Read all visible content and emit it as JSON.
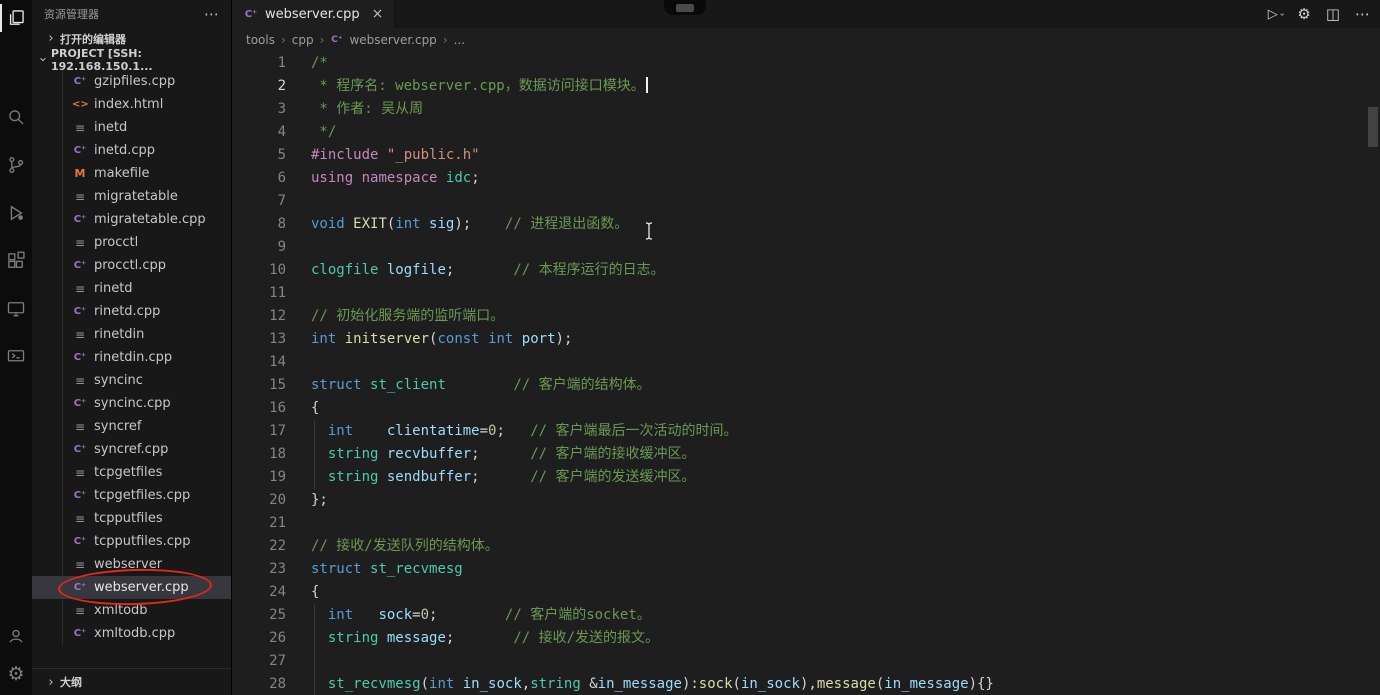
{
  "icons": {
    "more": "⋯",
    "chevron": "›",
    "close": "×",
    "gear": "⚙",
    "split": "◫",
    "play": "▷",
    "cpp": "C⁺",
    "html": "<>",
    "makefile": "M",
    "file": "≡"
  },
  "colors": {
    "comment": "#6A9955",
    "keyword": "#569CD6",
    "preprocessor": "#C586C0",
    "string": "#CE9178",
    "type": "#4EC9B0",
    "function": "#DCDCAA",
    "variable": "#9CDCFE",
    "number": "#B5CEA8",
    "annotation_red": "#e0281e",
    "cpp_icon": "#a074c4",
    "html_icon": "#e37933",
    "selected_row_bg": "#37373d"
  },
  "activity_bar": {
    "items": [
      "explorer",
      "search",
      "source-control",
      "run-and-debug",
      "extensions",
      "remote-explorer",
      "remote-targets"
    ],
    "bottom_items": [
      "accounts",
      "settings"
    ]
  },
  "sidebar": {
    "title": "资源管理器",
    "sections": {
      "open_editors": "打开的编辑器",
      "project": "PROJECT [SSH: 192.168.150.1...",
      "outline": "大纲"
    },
    "files": [
      {
        "name": "gzipfiles.cpp",
        "icon": "cpp"
      },
      {
        "name": "index.html",
        "icon": "html"
      },
      {
        "name": "inetd",
        "icon": "file"
      },
      {
        "name": "inetd.cpp",
        "icon": "cpp"
      },
      {
        "name": "makefile",
        "icon": "makefile"
      },
      {
        "name": "migratetable",
        "icon": "file"
      },
      {
        "name": "migratetable.cpp",
        "icon": "cpp"
      },
      {
        "name": "procctl",
        "icon": "file"
      },
      {
        "name": "procctl.cpp",
        "icon": "cpp"
      },
      {
        "name": "rinetd",
        "icon": "file"
      },
      {
        "name": "rinetd.cpp",
        "icon": "cpp"
      },
      {
        "name": "rinetdin",
        "icon": "file"
      },
      {
        "name": "rinetdin.cpp",
        "icon": "cpp"
      },
      {
        "name": "syncinc",
        "icon": "file"
      },
      {
        "name": "syncinc.cpp",
        "icon": "cpp"
      },
      {
        "name": "syncref",
        "icon": "file"
      },
      {
        "name": "syncref.cpp",
        "icon": "cpp"
      },
      {
        "name": "tcpgetfiles",
        "icon": "file"
      },
      {
        "name": "tcpgetfiles.cpp",
        "icon": "cpp"
      },
      {
        "name": "tcpputfiles",
        "icon": "file"
      },
      {
        "name": "tcpputfiles.cpp",
        "icon": "cpp"
      },
      {
        "name": "webserver",
        "icon": "file"
      },
      {
        "name": "webserver.cpp",
        "icon": "cpp",
        "selected": true,
        "annotated": true
      },
      {
        "name": "xmltodb",
        "icon": "file"
      },
      {
        "name": "xmltodb.cpp",
        "icon": "cpp"
      }
    ]
  },
  "editor": {
    "tab": "webserver.cpp",
    "breadcrumbs": [
      "tools",
      "cpp",
      "webserver.cpp",
      "..."
    ],
    "lines": [
      {
        "n": 1,
        "tokens": [
          {
            "s": "comment",
            "t": "/*"
          }
        ]
      },
      {
        "n": 2,
        "active": true,
        "tokens": [
          {
            "s": "comment",
            "t": " * 程序名: webserver.cpp，数据访问接口模块。"
          },
          {
            "s": "caret",
            "t": ""
          }
        ]
      },
      {
        "n": 3,
        "tokens": [
          {
            "s": "comment",
            "t": " * 作者: 吴从周"
          }
        ]
      },
      {
        "n": 4,
        "tokens": [
          {
            "s": "comment",
            "t": " */"
          }
        ]
      },
      {
        "n": 5,
        "tokens": [
          {
            "s": "kw2",
            "t": "#include"
          },
          {
            "s": "plain",
            "t": " "
          },
          {
            "s": "str",
            "t": "\"_public.h\""
          }
        ]
      },
      {
        "n": 6,
        "tokens": [
          {
            "s": "kw2",
            "t": "using"
          },
          {
            "s": "plain",
            "t": " "
          },
          {
            "s": "kw2",
            "t": "namespace"
          },
          {
            "s": "plain",
            "t": " "
          },
          {
            "s": "type",
            "t": "idc"
          },
          {
            "s": "plain",
            "t": ";"
          }
        ]
      },
      {
        "n": 7,
        "tokens": []
      },
      {
        "n": 8,
        "tokens": [
          {
            "s": "kw",
            "t": "void"
          },
          {
            "s": "plain",
            "t": " "
          },
          {
            "s": "fn",
            "t": "EXIT"
          },
          {
            "s": "plain",
            "t": "("
          },
          {
            "s": "kw",
            "t": "int"
          },
          {
            "s": "plain",
            "t": " "
          },
          {
            "s": "var",
            "t": "sig"
          },
          {
            "s": "plain",
            "t": ");    "
          },
          {
            "s": "comment",
            "t": "// 进程退出函数。"
          }
        ]
      },
      {
        "n": 9,
        "tokens": []
      },
      {
        "n": 10,
        "tokens": [
          {
            "s": "type",
            "t": "clogfile"
          },
          {
            "s": "plain",
            "t": " "
          },
          {
            "s": "var",
            "t": "logfile"
          },
          {
            "s": "plain",
            "t": ";       "
          },
          {
            "s": "comment",
            "t": "// 本程序运行的日志。"
          }
        ]
      },
      {
        "n": 11,
        "tokens": []
      },
      {
        "n": 12,
        "tokens": [
          {
            "s": "comment",
            "t": "// 初始化服务端的监听端口。"
          }
        ]
      },
      {
        "n": 13,
        "tokens": [
          {
            "s": "kw",
            "t": "int"
          },
          {
            "s": "plain",
            "t": " "
          },
          {
            "s": "fn",
            "t": "initserver"
          },
          {
            "s": "plain",
            "t": "("
          },
          {
            "s": "kw",
            "t": "const"
          },
          {
            "s": "plain",
            "t": " "
          },
          {
            "s": "kw",
            "t": "int"
          },
          {
            "s": "plain",
            "t": " "
          },
          {
            "s": "var",
            "t": "port"
          },
          {
            "s": "plain",
            "t": ");"
          }
        ]
      },
      {
        "n": 14,
        "tokens": []
      },
      {
        "n": 15,
        "tokens": [
          {
            "s": "kw",
            "t": "struct"
          },
          {
            "s": "plain",
            "t": " "
          },
          {
            "s": "type",
            "t": "st_client"
          },
          {
            "s": "plain",
            "t": "        "
          },
          {
            "s": "comment",
            "t": "// 客户端的结构体。"
          }
        ]
      },
      {
        "n": 16,
        "tokens": [
          {
            "s": "plain",
            "t": "{"
          }
        ]
      },
      {
        "n": 17,
        "tokens": [
          {
            "s": "plain",
            "t": "  "
          },
          {
            "s": "kw",
            "t": "int"
          },
          {
            "s": "plain",
            "t": "    "
          },
          {
            "s": "var",
            "t": "clientatime"
          },
          {
            "s": "plain",
            "t": "="
          },
          {
            "s": "num",
            "t": "0"
          },
          {
            "s": "plain",
            "t": ";   "
          },
          {
            "s": "comment",
            "t": "// 客户端最后一次活动的时间。"
          }
        ]
      },
      {
        "n": 18,
        "tokens": [
          {
            "s": "plain",
            "t": "  "
          },
          {
            "s": "type",
            "t": "string"
          },
          {
            "s": "plain",
            "t": " "
          },
          {
            "s": "var",
            "t": "recvbuffer"
          },
          {
            "s": "plain",
            "t": ";      "
          },
          {
            "s": "comment",
            "t": "// 客户端的接收缓冲区。"
          }
        ]
      },
      {
        "n": 19,
        "tokens": [
          {
            "s": "plain",
            "t": "  "
          },
          {
            "s": "type",
            "t": "string"
          },
          {
            "s": "plain",
            "t": " "
          },
          {
            "s": "var",
            "t": "sendbuffer"
          },
          {
            "s": "plain",
            "t": ";      "
          },
          {
            "s": "comment",
            "t": "// 客户端的发送缓冲区。"
          }
        ]
      },
      {
        "n": 20,
        "tokens": [
          {
            "s": "plain",
            "t": "};"
          }
        ]
      },
      {
        "n": 21,
        "tokens": []
      },
      {
        "n": 22,
        "tokens": [
          {
            "s": "comment",
            "t": "// 接收/发送队列的结构体。"
          }
        ]
      },
      {
        "n": 23,
        "tokens": [
          {
            "s": "kw",
            "t": "struct"
          },
          {
            "s": "plain",
            "t": " "
          },
          {
            "s": "type",
            "t": "st_recvmesg"
          }
        ]
      },
      {
        "n": 24,
        "tokens": [
          {
            "s": "plain",
            "t": "{"
          }
        ]
      },
      {
        "n": 25,
        "tokens": [
          {
            "s": "plain",
            "t": "  "
          },
          {
            "s": "kw",
            "t": "int"
          },
          {
            "s": "plain",
            "t": "   "
          },
          {
            "s": "var",
            "t": "sock"
          },
          {
            "s": "plain",
            "t": "="
          },
          {
            "s": "num",
            "t": "0"
          },
          {
            "s": "plain",
            "t": ";        "
          },
          {
            "s": "comment",
            "t": "// 客户端的socket。"
          }
        ]
      },
      {
        "n": 26,
        "tokens": [
          {
            "s": "plain",
            "t": "  "
          },
          {
            "s": "type",
            "t": "string"
          },
          {
            "s": "plain",
            "t": " "
          },
          {
            "s": "var",
            "t": "message"
          },
          {
            "s": "plain",
            "t": ";       "
          },
          {
            "s": "comment",
            "t": "// 接收/发送的报文。"
          }
        ]
      },
      {
        "n": 27,
        "tokens": []
      },
      {
        "n": 28,
        "tokens": [
          {
            "s": "plain",
            "t": "  "
          },
          {
            "s": "type",
            "t": "st_recvmesg"
          },
          {
            "s": "plain",
            "t": "("
          },
          {
            "s": "kw",
            "t": "int"
          },
          {
            "s": "plain",
            "t": " "
          },
          {
            "s": "var",
            "t": "in_sock"
          },
          {
            "s": "plain",
            "t": ","
          },
          {
            "s": "type",
            "t": "string"
          },
          {
            "s": "plain",
            "t": " &"
          },
          {
            "s": "var",
            "t": "in_message"
          },
          {
            "s": "plain",
            "t": "):"
          },
          {
            "s": "fn",
            "t": "sock"
          },
          {
            "s": "plain",
            "t": "("
          },
          {
            "s": "var",
            "t": "in_sock"
          },
          {
            "s": "plain",
            "t": "),"
          },
          {
            "s": "fn",
            "t": "message"
          },
          {
            "s": "plain",
            "t": "("
          },
          {
            "s": "var",
            "t": "in_message"
          },
          {
            "s": "plain",
            "t": "){}"
          }
        ]
      }
    ]
  }
}
